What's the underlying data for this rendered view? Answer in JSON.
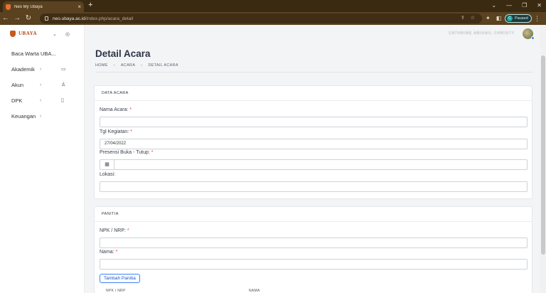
{
  "browser": {
    "tab_title": "Neo My Ubaya",
    "tab_close": "×",
    "new_tab": "+",
    "url_host": "neo.ubaya.ac.id",
    "url_path": "/index.php/acara_detail",
    "profile_initial": "C",
    "profile_status": "Paused",
    "icons": {
      "back": "arrow-left-icon",
      "forward": "arrow-right-icon",
      "reload": "reload-icon",
      "share": "share-icon",
      "star": "star-icon",
      "extensions": "puzzle-icon",
      "sidepanel": "sidepanel-icon",
      "menu": "kebab-menu-icon"
    }
  },
  "sidebar": {
    "logo_text": "UBAYA",
    "items": [
      {
        "label": "Baca Warta UBA...",
        "has_chevron": false,
        "icon": ""
      },
      {
        "label": "Akademik",
        "has_chevron": true,
        "icon": "book-icon"
      },
      {
        "label": "Akun",
        "has_chevron": true,
        "icon": "user-icon"
      },
      {
        "label": "DPK",
        "has_chevron": true,
        "icon": "badge-icon"
      },
      {
        "label": "Keuangan",
        "has_chevron": true,
        "icon": ""
      }
    ]
  },
  "header": {
    "user_name": "CATHRINE ABIGAIL CHRISTY"
  },
  "page": {
    "title": "Detail Acara",
    "breadcrumb": [
      "HOME",
      "ACARA",
      "DETAIL ACARA"
    ]
  },
  "data_acara": {
    "heading": "DATA ACARA",
    "fields": {
      "nama_acara": {
        "label": "Nama Acara:",
        "value": ""
      },
      "tgl_kegiatan": {
        "label": "Tgl Kegiatan:",
        "value": "27/04/2022"
      },
      "presensi": {
        "label": "Presensi Buka - Tutup:",
        "value": ""
      },
      "lokasi": {
        "label": "Lokasi:",
        "value": ""
      }
    },
    "required_mark": "*"
  },
  "panitia": {
    "heading": "PANITIA",
    "fields": {
      "npk": {
        "label": "NPK / NRP:",
        "value": ""
      },
      "nama": {
        "label": "Nama:",
        "value": ""
      }
    },
    "add_button": "Tambah Panitia",
    "table_headers": [
      "NPK / NRP",
      "NAMA"
    ]
  },
  "colors": {
    "accent": "#3b82f6",
    "required": "#e03b3b",
    "chrome": "#5a4220"
  }
}
